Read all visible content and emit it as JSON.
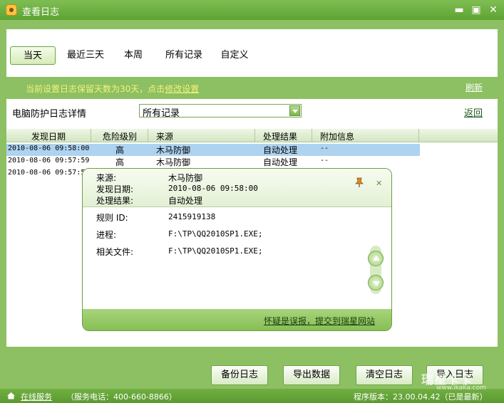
{
  "window": {
    "title": "查看日志"
  },
  "tabs": [
    "当天",
    "最近三天",
    "本周",
    "所有记录",
    "自定义"
  ],
  "notice": {
    "text": "当前设置日志保留天数为30天，点击",
    "link": "修改设置"
  },
  "refresh_label": "刷新",
  "detail": {
    "title": "电脑防护日志详情",
    "filter_value": "所有记录",
    "back_label": "返回"
  },
  "table": {
    "columns": [
      "发现日期",
      "危险级别",
      "来源",
      "处理结果",
      "附加信息"
    ],
    "rows": [
      {
        "date": "2010-08-06 09:58:00",
        "level": "高",
        "source": "木马防御",
        "result": "自动处理",
        "extra": "--"
      },
      {
        "date": "2010-08-06 09:57:59",
        "level": "高",
        "source": "木马防御",
        "result": "自动处理",
        "extra": "--"
      },
      {
        "date": "2010-08-06 09:57:5"
      }
    ]
  },
  "popup": {
    "source_label": "来源:",
    "source": "木马防御",
    "date_label": "发现日期:",
    "date": "2010-08-06 09:58:00",
    "result_label": "处理结果:",
    "result": "自动处理",
    "rule_label": "规则 ID:",
    "rule": "2415919138",
    "process_label": "进程:",
    "process": "F:\\TP\\QQ2010SP1.EXE;",
    "file_label": "相关文件:",
    "file": "F:\\TP\\QQ2010SP1.EXE;",
    "report_link": "怀疑是误报，提交到瑞星网站"
  },
  "buttons": {
    "backup": "备份日志",
    "export": "导出数据",
    "clear": "清空日志",
    "import": "导入日志"
  },
  "statusbar": {
    "online": "在线服务",
    "phone": "（服务电话：400-660-8866）",
    "version": "程序版本：23.00.04.42（已是最新）"
  },
  "watermark": {
    "main": "瑞星卡卡",
    "sub": "www.ikaka.com"
  },
  "icons": {
    "app": "rising-lion-icon",
    "minimize": "minimize-icon",
    "maximize": "maximize-icon",
    "close": "close-icon",
    "pin": "pin-icon",
    "collapse": "collapse-icon",
    "home": "home-icon"
  }
}
